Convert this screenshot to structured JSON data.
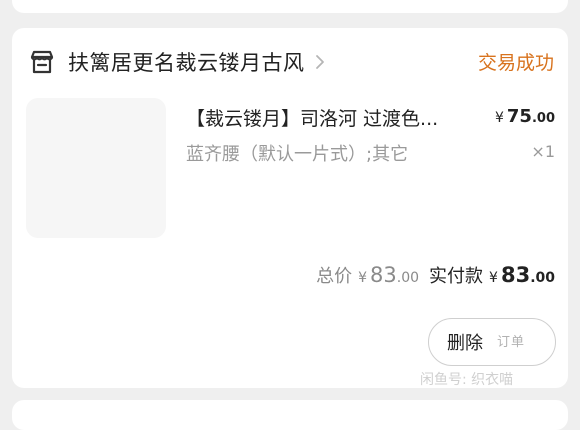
{
  "shop": {
    "icon": "shop-icon",
    "name": "扶篱居更名裁云镂月古风"
  },
  "order": {
    "status": "交易成功",
    "item": {
      "title": "【裁云镂月】司洛河 过渡色...",
      "price_symbol": "¥",
      "price_int": "75",
      "price_dec": ".00",
      "spec": "蓝齐腰（默认一片式）;其它",
      "quantity": "×1"
    },
    "totals": {
      "total_label": "总价",
      "total_symbol": "¥",
      "total_int": "83",
      "total_dec": ".00",
      "paid_label": "实付款",
      "paid_symbol": "¥",
      "paid_int": "83",
      "paid_dec": ".00"
    },
    "delete_label": "删除"
  },
  "watermark": {
    "main": "闲鱼号: 织衣喵",
    "overlay": "订单"
  },
  "colors": {
    "status": "#d8731e",
    "background": "#efefef",
    "card": "#ffffff"
  }
}
